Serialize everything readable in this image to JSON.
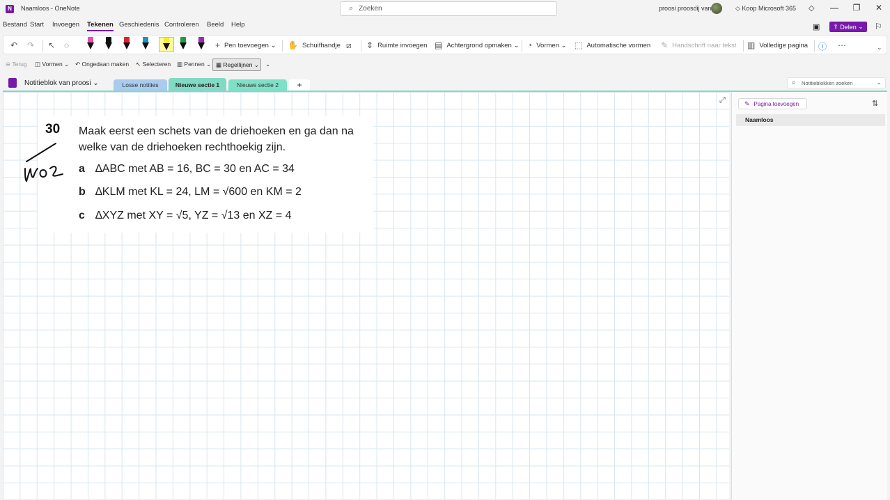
{
  "titlebar": {
    "title": "Naamloos  -  OneNote",
    "search_placeholder": "Zoeken",
    "user": "proosi proosdij van",
    "buy": "Koop Microsoft 365",
    "min": "—",
    "restore": "❐",
    "close": "✕"
  },
  "menu": {
    "items": [
      "Bestand",
      "Start",
      "Invoegen",
      "Tekenen",
      "Geschiedenis",
      "Controleren",
      "Beeld",
      "Help"
    ],
    "share": "Delen"
  },
  "ribbon": {
    "add_pen": "Pen toevoegen",
    "hand": "Schuifhandje",
    "insert_space": "Ruimte invoegen",
    "background": "Achtergrond opmaken",
    "shapes": "Vormen",
    "auto_shapes": "Automatische vormen",
    "ink_to_text": "Handschrift naar tekst",
    "full_page": "Volledige pagina",
    "pen_colors": [
      "#e84fa8",
      "#111111",
      "#d9262c",
      "#1e90c8",
      "#f4ee2a",
      "#1f9e3f",
      "#9a2db5"
    ]
  },
  "toolbar2": {
    "back": "Terug",
    "shapes": "Vormen",
    "undo": "Ongedaan maken",
    "select": "Selecteren",
    "pens": "Pennen",
    "ruled": "Regellijnen"
  },
  "notebook": {
    "title": "Notitieblok van proosi",
    "sections": [
      {
        "label": "Losse notities",
        "color": "#a9cbf0"
      },
      {
        "label": "Nieuwe sectie 1",
        "color": "#82d9c4"
      },
      {
        "label": "Nieuwe sectie 2",
        "color": "#7fe0c8"
      }
    ],
    "add": "+",
    "search": "Notitieblokken zoeken"
  },
  "exercise": {
    "number": "30",
    "line1": "Maak eerst een schets van de driehoeken en ga dan na",
    "line2": "welke van de driehoeken rechthoekig zijn.",
    "items": [
      {
        "label": "a",
        "text": "∆ABC met AB = 16, BC = 30 en AC = 34"
      },
      {
        "label": "b",
        "text": "∆KLM met KL = 24, LM = √600 en KM = 2"
      },
      {
        "label": "c",
        "text": "∆XYZ met XY = √5, YZ = √13 en XZ = 4"
      }
    ]
  },
  "pages": {
    "add_page": "Pagina toevoegen",
    "items": [
      "Naamloos"
    ]
  }
}
